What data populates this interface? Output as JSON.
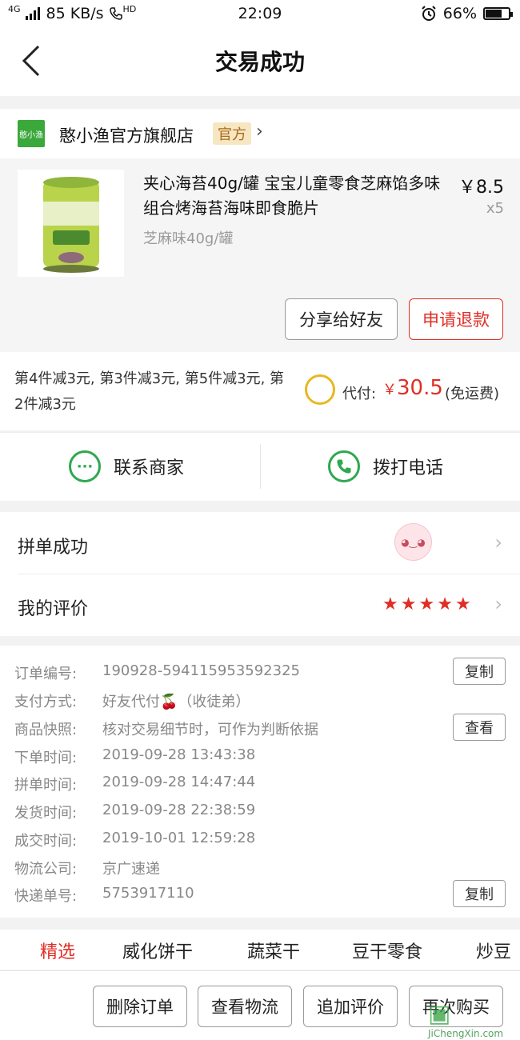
{
  "status_bar": {
    "signal": "4G",
    "speed": "85 KB/s",
    "hd": "HD",
    "time": "22:09",
    "battery": "66%"
  },
  "header": {
    "title": "交易成功"
  },
  "shop": {
    "logo_text": "憨小渔",
    "name": "憨小渔官方旗舰店",
    "badge": "官方"
  },
  "product": {
    "title": "夹心海苔40g/罐 宝宝儿童零食芝麻馅多味组合烤海苔海味即食脆片",
    "spec": "芝麻味40g/罐",
    "price": "￥8.5",
    "qty": "x5",
    "share_label": "分享给好友",
    "refund_label": "申请退款"
  },
  "payment": {
    "discount": "第4件减3元, 第3件减3元, 第5件减3元, 第2件减3元",
    "label": "代付:",
    "currency": "￥",
    "amount": "30.5",
    "shipping": "(免运费)"
  },
  "contact": {
    "merchant_label": "联系商家",
    "call_label": "拨打电话"
  },
  "group": {
    "label": "拼单成功"
  },
  "review": {
    "label": "我的评价",
    "stars": 5
  },
  "details": {
    "rows": [
      {
        "key": "订单编号:",
        "value": "190928-594115953592325",
        "action": "复制"
      },
      {
        "key": "支付方式:",
        "value": "好友代付🍒（收徒弟）"
      },
      {
        "key": "商品快照:",
        "value": "核对交易细节时，可作为判断依据",
        "action": "查看"
      },
      {
        "key": "下单时间:",
        "value": "2019-09-28 13:43:38"
      },
      {
        "key": "拼单时间:",
        "value": "2019-09-28 14:47:44"
      },
      {
        "key": "发货时间:",
        "value": "2019-09-28 22:38:59"
      },
      {
        "key": "成交时间:",
        "value": "2019-10-01 12:59:28"
      },
      {
        "key": "物流公司:",
        "value": "京广速递"
      },
      {
        "key": "快递单号:",
        "value": "5753917110",
        "action": "复制"
      }
    ]
  },
  "tabs": [
    "精选",
    "威化饼干",
    "蔬菜干",
    "豆干零食",
    "炒豆"
  ],
  "bottom_bar": {
    "delete": "删除订单",
    "logistics": "查看物流",
    "add_review": "追加评价",
    "rebuy": "再次购买"
  },
  "watermark": {
    "brand": "JiChengXin.com"
  },
  "colors": {
    "accent_red": "#e02e24",
    "green": "#2fa84f",
    "badge_bg": "#f6e6c2"
  }
}
